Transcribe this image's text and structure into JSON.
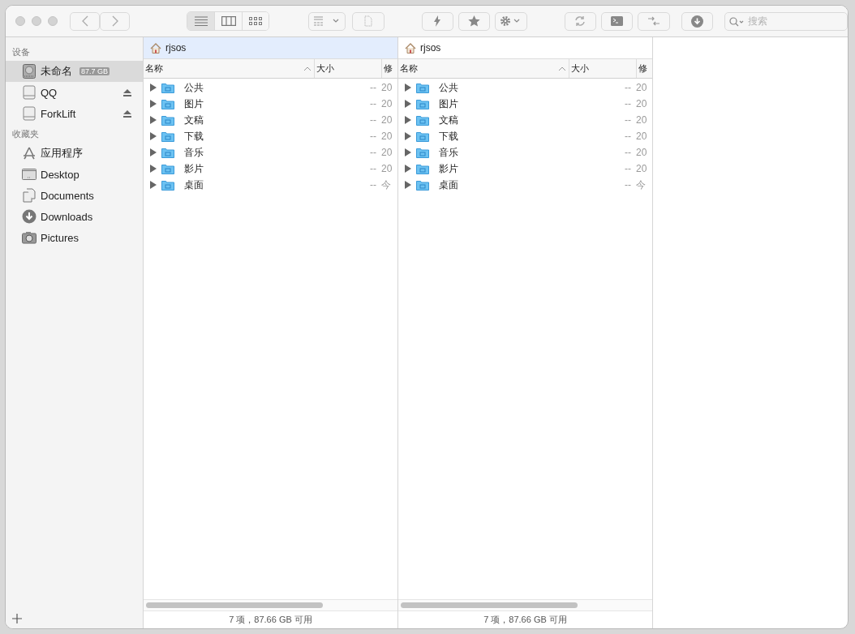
{
  "toolbar": {
    "view_modes": [
      {
        "kind": "list",
        "selected": true
      },
      {
        "kind": "columns",
        "selected": false
      },
      {
        "kind": "icons",
        "selected": false
      }
    ],
    "search": {
      "placeholder": "搜索"
    }
  },
  "sidebar": {
    "sections": [
      {
        "title": "设备",
        "items": [
          {
            "kind": "disk",
            "label": "未命名",
            "badge": "87.7 GB",
            "selected": true,
            "ejectable": false
          },
          {
            "kind": "drive",
            "label": "QQ",
            "selected": false,
            "ejectable": true
          },
          {
            "kind": "drive",
            "label": "ForkLift",
            "selected": false,
            "ejectable": true
          }
        ]
      },
      {
        "title": "收藏夹",
        "items": [
          {
            "kind": "apps",
            "label": "应用程序",
            "selected": false,
            "ejectable": false
          },
          {
            "kind": "desktop",
            "label": "Desktop",
            "selected": false,
            "ejectable": false
          },
          {
            "kind": "documents",
            "label": "Documents",
            "selected": false,
            "ejectable": false
          },
          {
            "kind": "downloads",
            "label": "Downloads",
            "selected": false,
            "ejectable": false
          },
          {
            "kind": "pictures",
            "label": "Pictures",
            "selected": false,
            "ejectable": false
          }
        ]
      }
    ]
  },
  "panes": [
    {
      "path": "rjsos",
      "active": true,
      "columns": [
        "名称",
        "大小",
        "修"
      ],
      "rows": [
        {
          "name": "公共",
          "size": "--",
          "modified": "20"
        },
        {
          "name": "图片",
          "size": "--",
          "modified": "20"
        },
        {
          "name": "文稿",
          "size": "--",
          "modified": "20"
        },
        {
          "name": "下载",
          "size": "--",
          "modified": "20"
        },
        {
          "name": "音乐",
          "size": "--",
          "modified": "20"
        },
        {
          "name": "影片",
          "size": "--",
          "modified": "20"
        },
        {
          "name": "桌面",
          "size": "--",
          "modified": "今"
        }
      ],
      "status": "7 项，87.66 GB 可用"
    },
    {
      "path": "rjsos",
      "active": false,
      "columns": [
        "名称",
        "大小",
        "修"
      ],
      "rows": [
        {
          "name": "公共",
          "size": "--",
          "modified": "20"
        },
        {
          "name": "图片",
          "size": "--",
          "modified": "20"
        },
        {
          "name": "文稿",
          "size": "--",
          "modified": "20"
        },
        {
          "name": "下载",
          "size": "--",
          "modified": "20"
        },
        {
          "name": "音乐",
          "size": "--",
          "modified": "20"
        },
        {
          "name": "影片",
          "size": "--",
          "modified": "20"
        },
        {
          "name": "桌面",
          "size": "--",
          "modified": "今"
        }
      ],
      "status": "7 项，87.66 GB 可用"
    }
  ]
}
